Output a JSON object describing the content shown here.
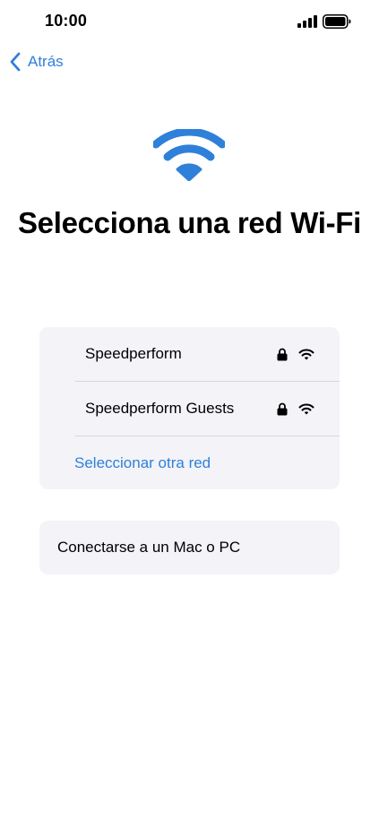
{
  "status_bar": {
    "time": "10:00",
    "signal_icon": "cellular-signal-icon",
    "battery_icon": "battery-icon"
  },
  "nav": {
    "back_label": "Atrás",
    "back_icon": "chevron-left-icon"
  },
  "hero": {
    "icon": "wifi-icon",
    "title": "Selecciona una red Wi-Fi"
  },
  "networks": [
    {
      "name": "Speedperform",
      "secured": true,
      "signal": "full"
    },
    {
      "name": "Speedperform Guests",
      "secured": true,
      "signal": "full"
    }
  ],
  "other_network_label": "Seleccionar otra red",
  "connect_label": "Conectarse a un Mac o PC",
  "colors": {
    "accent": "#2f80d9",
    "card_background": "#f3f3f8",
    "divider": "#d6d6dc"
  }
}
